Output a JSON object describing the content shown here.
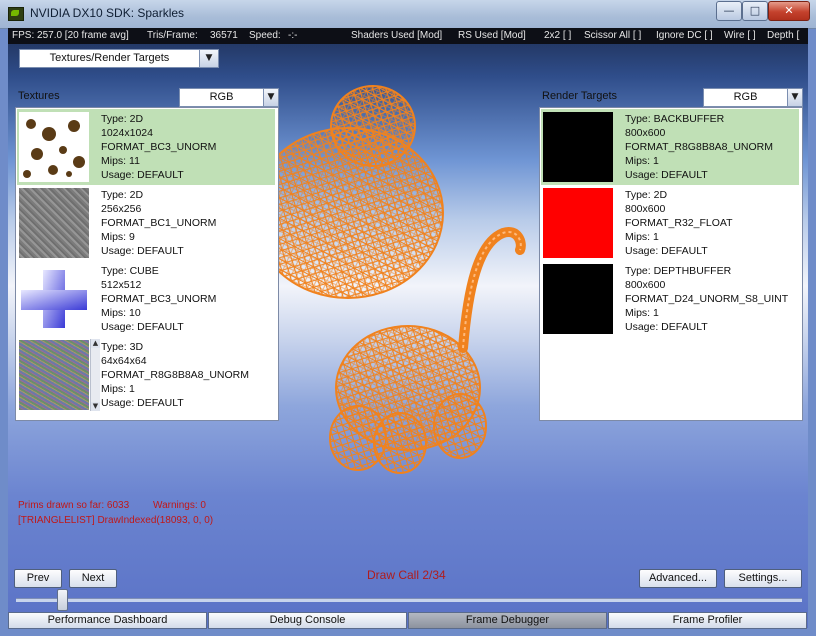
{
  "window": {
    "title": "NVIDIA DX10 SDK: Sparkles",
    "minimize_glyph": "—",
    "maximize_glyph": "□",
    "close_glyph": "✕"
  },
  "status": {
    "fps": "FPS: 257.0 [20 frame avg]",
    "tris_label": "Tris/Frame:",
    "tris_value": "36571",
    "speed_label": "Speed:",
    "speed_value": "-:-",
    "shaders": "Shaders Used [Mod]",
    "rs": "RS Used [Mod]",
    "grid": "2x2 [ ]",
    "scissor": "Scissor All [ ]",
    "ignore_dc": "Ignore DC [ ]",
    "wire": "Wire [ ]",
    "depth": "Depth ["
  },
  "view_selector": {
    "value": "Textures/Render Targets"
  },
  "textures": {
    "label": "Textures",
    "channel": "RGB",
    "items": [
      {
        "type": "Type: 2D",
        "size": "1024x1024",
        "format": "FORMAT_BC3_UNORM",
        "mips": "Mips: 11",
        "usage": "Usage: DEFAULT",
        "thumb": "spots"
      },
      {
        "type": "Type: 2D",
        "size": "256x256",
        "format": "FORMAT_BC1_UNORM",
        "mips": "Mips: 9",
        "usage": "Usage: DEFAULT",
        "thumb": "noise"
      },
      {
        "type": "Type: CUBE",
        "size": "512x512",
        "format": "FORMAT_BC3_UNORM",
        "mips": "Mips: 10",
        "usage": "Usage: DEFAULT",
        "thumb": "cube"
      },
      {
        "type": "Type: 3D",
        "size": "64x64x64",
        "format": "FORMAT_R8G8B8A8_UNORM",
        "mips": "Mips: 1",
        "usage": "Usage: DEFAULT",
        "thumb": "colornoise"
      }
    ]
  },
  "render_targets": {
    "label": "Render Targets",
    "channel": "RGB",
    "items": [
      {
        "type": "Type: BACKBUFFER",
        "size": "800x600",
        "format": "FORMAT_R8G8B8A8_UNORM",
        "mips": "Mips: 1",
        "usage": "Usage: DEFAULT",
        "color": "#000000"
      },
      {
        "type": "Type: 2D",
        "size": "800x600",
        "format": "FORMAT_R32_FLOAT",
        "mips": "Mips: 1",
        "usage": "Usage: DEFAULT",
        "color": "#ff0000"
      },
      {
        "type": "Type: DEPTHBUFFER",
        "size": "800x600",
        "format": "FORMAT_D24_UNORM_S8_UINT",
        "mips": "Mips: 1",
        "usage": "Usage: DEFAULT",
        "color": "#000000"
      }
    ]
  },
  "debug": {
    "prims": "Prims drawn so far: 6033",
    "warnings": "Warnings: 0",
    "call": "[TRIANGLELIST] DrawIndexed(18093, 0, 0)",
    "draw_call": "Draw Call 2/34",
    "draw_call_progress": 0.059
  },
  "buttons": {
    "prev": "Prev",
    "next": "Next",
    "advanced": "Advanced...",
    "settings": "Settings..."
  },
  "tabs": [
    {
      "label": "Performance Dashboard",
      "active": false
    },
    {
      "label": "Debug Console",
      "active": false
    },
    {
      "label": "Frame Debugger",
      "active": true
    },
    {
      "label": "Frame Profiler",
      "active": false
    }
  ],
  "colors": {
    "wireframe": "#f0821e",
    "selected_row": "#c0e0b6",
    "debug_text": "#c01818"
  }
}
